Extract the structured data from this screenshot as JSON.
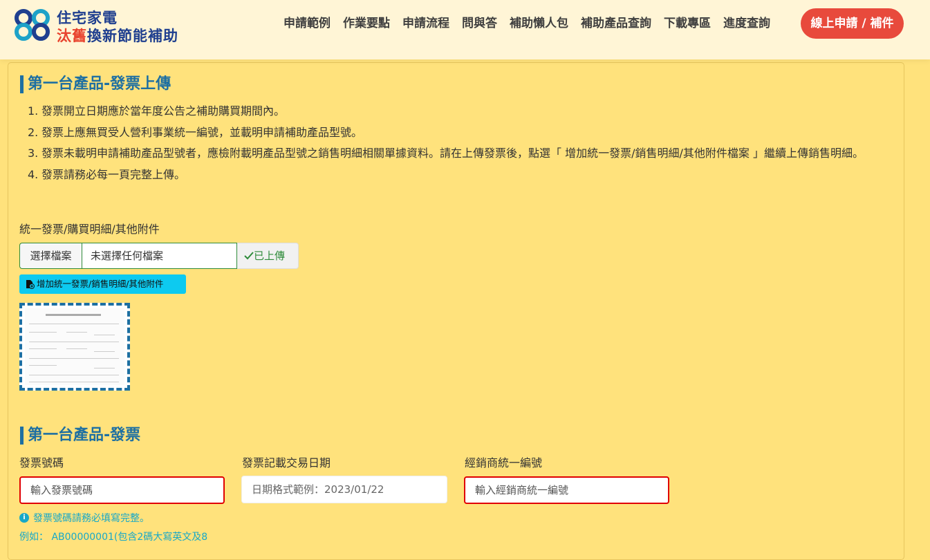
{
  "header": {
    "logo_line1": "住宅家電",
    "logo_line2_highlight": "汰舊",
    "logo_line2_rest": "換新節能補助",
    "nav": [
      "申請範例",
      "作業要點",
      "申請流程",
      "問與答",
      "補助懶人包",
      "補助產品查詢",
      "下載專區",
      "進度查詢"
    ],
    "cta_label": "線上申請 / 補件",
    "logo_colors": {
      "blue": "#1f3f8f",
      "red": "#e8432e",
      "teal": "#1ea2c8"
    }
  },
  "upload_section": {
    "title": "第一台產品-發票上傳",
    "rules": [
      {
        "num": "1.",
        "text": "發票開立日期應於當年度公告之補助購買期間內。"
      },
      {
        "num": "2.",
        "text": "發票上應無買受人營利事業統一編號，並載明申請補助產品型號。"
      },
      {
        "num": "3.",
        "text": "發票未載明申請補助產品型號者，應檢附載明產品型號之銷售明細相關單據資料。請在上傳發票後，點選「 增加統一發票/銷售明細/其他附件檔案 」繼續上傳銷售明細。"
      },
      {
        "num": "4.",
        "text": "發票請務必每一頁完整上傳。"
      }
    ],
    "file_label": "統一發票/購買明細/其他附件",
    "choose_file": "選擇檔案",
    "no_file": "未選擇任何檔案",
    "uploaded": "已上傳",
    "add_button": "增加統一發票/銷售明細/其他附件"
  },
  "invoice_section": {
    "title": "第一台產品-發票",
    "invoice_no_label": "發票號碼",
    "invoice_no_placeholder": "輸入發票號碼",
    "date_label": "發票記載交易日期",
    "date_placeholder": "日期格式範例：2023/01/22",
    "dealer_label": "經銷商統一編號",
    "dealer_placeholder": "輸入經銷商統一編號",
    "hint": "發票號碼請務必填寫完整。",
    "example": "例如： AB00000001(包含2碼大寫英文及8"
  },
  "colors": {
    "accent": "#1d6fa2",
    "error": "#e00000",
    "success": "#2e8b3a",
    "info": "#17a8c8",
    "cta": "#e84a3c"
  }
}
